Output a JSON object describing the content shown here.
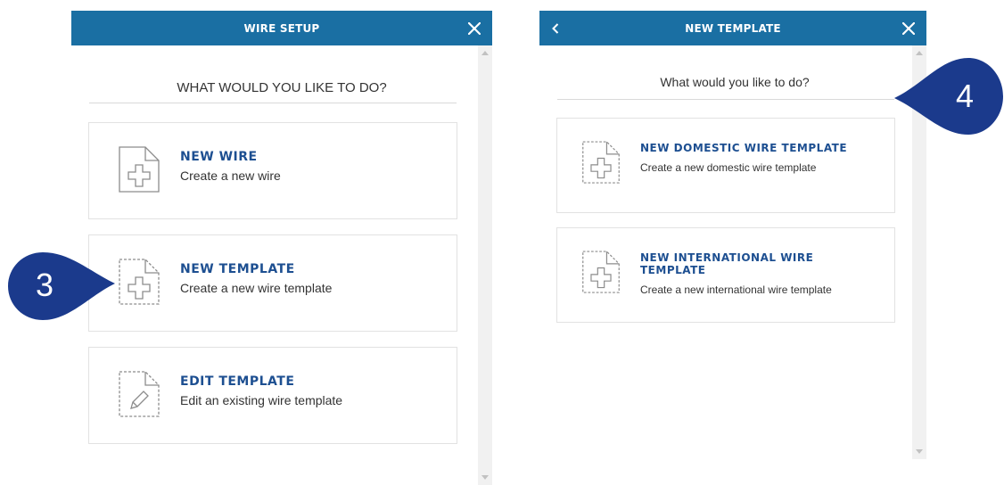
{
  "left_panel": {
    "title": "WIRE SETUP",
    "question": "WHAT WOULD YOU LIKE TO DO?",
    "options": [
      {
        "title": "NEW WIRE",
        "subtitle": "Create a new wire",
        "icon": "document-plus-icon"
      },
      {
        "title": "NEW TEMPLATE",
        "subtitle": "Create a new wire template",
        "icon": "dashed-document-plus-icon"
      },
      {
        "title": "EDIT TEMPLATE",
        "subtitle": "Edit an existing wire template",
        "icon": "dashed-document-pencil-icon"
      }
    ]
  },
  "right_panel": {
    "title": "NEW TEMPLATE",
    "question": "What would you like to do?",
    "options": [
      {
        "title": "NEW DOMESTIC WIRE TEMPLATE",
        "subtitle": "Create a new domestic wire template",
        "icon": "dashed-document-plus-icon"
      },
      {
        "title": "NEW INTERNATIONAL WIRE TEMPLATE",
        "subtitle": "Create a new international wire template",
        "icon": "dashed-document-plus-icon"
      }
    ]
  },
  "callouts": [
    {
      "label": "3"
    },
    {
      "label": "4"
    }
  ],
  "colors": {
    "header": "#1a6fa3",
    "title_text": "#1d4f91",
    "callout": "#1b3a8c"
  }
}
